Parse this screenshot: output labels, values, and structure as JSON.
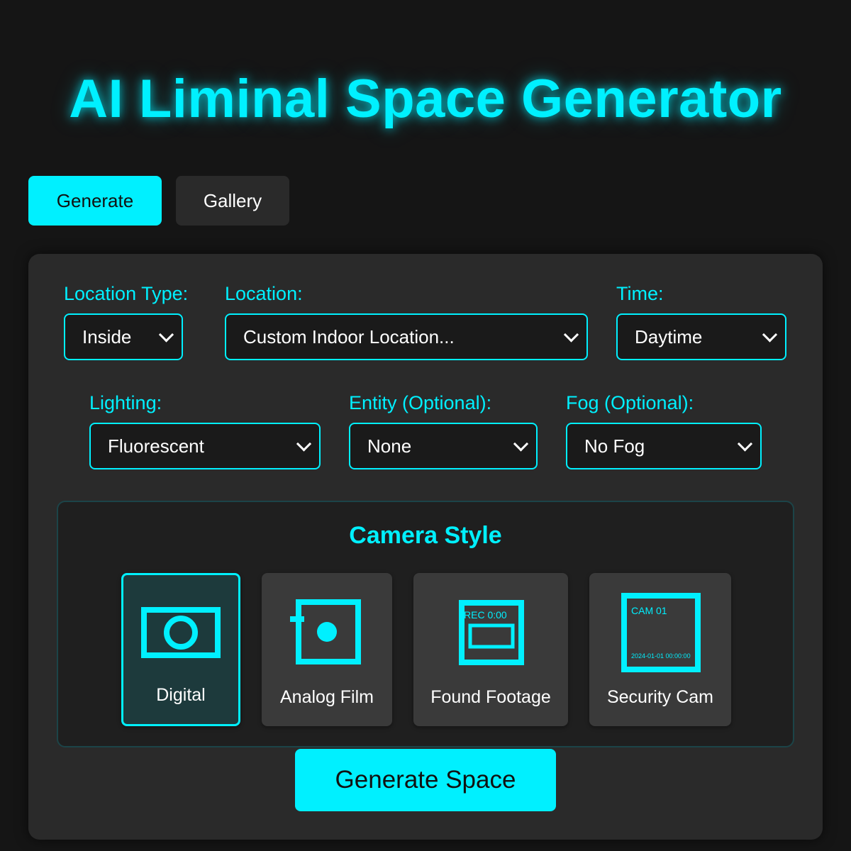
{
  "app": {
    "title": "AI Liminal Space Generator"
  },
  "tabs": [
    {
      "label": "Generate",
      "active": true
    },
    {
      "label": "Gallery",
      "active": false
    }
  ],
  "form": {
    "location_type": {
      "label": "Location Type:",
      "value": "Inside"
    },
    "location": {
      "label": "Location:",
      "value": "Custom Indoor Location..."
    },
    "time": {
      "label": "Time:",
      "value": "Daytime"
    },
    "lighting": {
      "label": "Lighting:",
      "value": "Fluorescent"
    },
    "entity": {
      "label": "Entity (Optional):",
      "value": "None"
    },
    "fog": {
      "label": "Fog (Optional):",
      "value": "No Fog"
    }
  },
  "camera": {
    "title": "Camera Style",
    "options": [
      {
        "label": "Digital",
        "icon": "digital-camera-icon",
        "selected": true
      },
      {
        "label": "Analog Film",
        "icon": "analog-film-icon",
        "selected": false
      },
      {
        "label": "Found Footage",
        "icon": "found-footage-icon",
        "overlay": "REC 0:00",
        "selected": false
      },
      {
        "label": "Security Cam",
        "icon": "security-cam-icon",
        "overlay_top": "CAM 01",
        "overlay_bottom": "2024-01-01 00:00:00",
        "selected": false
      }
    ]
  },
  "actions": {
    "generate_label": "Generate Space"
  },
  "colors": {
    "accent": "#00f0ff",
    "background": "#151515",
    "panel": "#2a2a2a"
  }
}
